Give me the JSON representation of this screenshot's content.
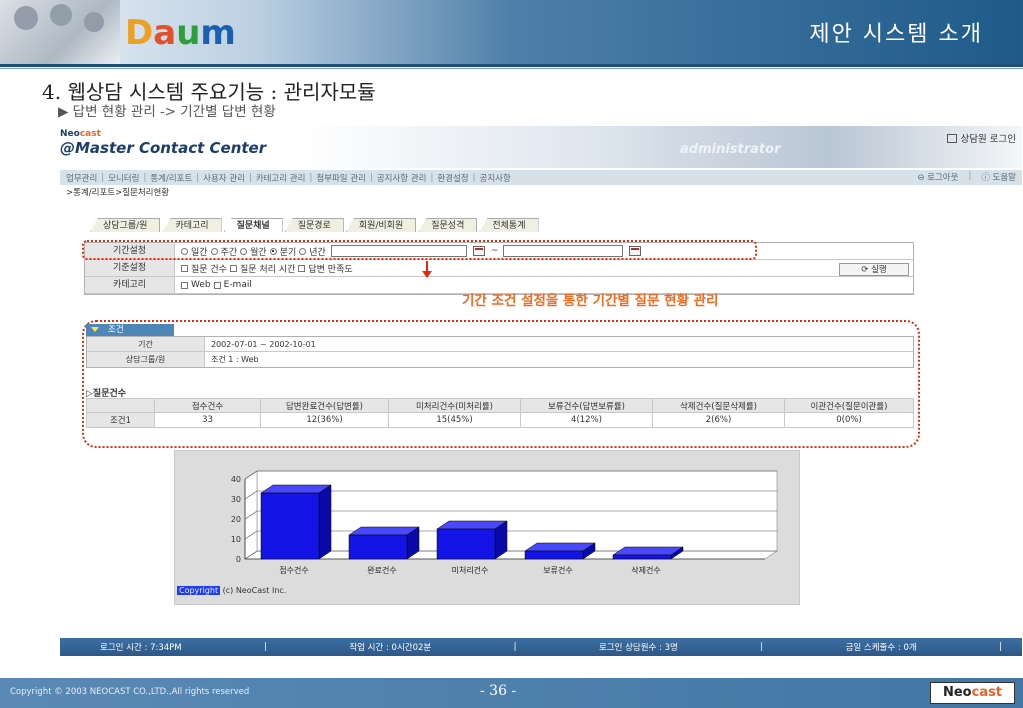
{
  "slide": {
    "title": "제안 시스템 소개",
    "logo": {
      "c1": "D",
      "c2": "a",
      "c3": "u",
      "c4": "m"
    },
    "heading": "4. 웹상담 시스템 주요기능 : 관리자모듈",
    "subheading": "▶ 답변 현황 관리 -> 기간별 답변 현황",
    "footer": {
      "copyright": "Copyright © 2003 NEOCAST CO.,LTD.,All rights reserved",
      "page": "- 36 -",
      "logo_neo": "Neo",
      "logo_cast": "cast"
    }
  },
  "app": {
    "brand_neo_a": "Neo",
    "brand_neo_b": "cast",
    "brand_main": "@Master Contact Center",
    "admin": "administrator",
    "login_button": "상담원 로그인",
    "menu": [
      "업무관리",
      "모니터링",
      "통계/리포트",
      "사용자 관리",
      "카테고리 관리",
      "첨부파일 관리",
      "공지사항 관리",
      "환경설정",
      "공지사항"
    ],
    "logout": "로그아웃",
    "help": "도움말",
    "breadcrumb": ">통계/리포트>질문처리현황",
    "tabs": [
      "상담그룹/원",
      "카테고리",
      "질문채널",
      "질문경로",
      "회원/비회원",
      "질문성격",
      "전체통계"
    ],
    "form": {
      "period_label": "기간설정",
      "period_options": [
        "일간",
        "주간",
        "월간",
        "분기",
        "년간"
      ],
      "period_selected": "분기",
      "date_sep": "~",
      "criteria_label": "기준설정",
      "criteria_options": [
        "질문 건수",
        "질문 처리 시간",
        "답변 만족도"
      ],
      "category_label": "카테고리",
      "category_options": [
        "Web",
        "E-mail"
      ],
      "run_button": "실행"
    },
    "annotation": "기간 조건 설정을 통한 기간별 질문 현황  관리",
    "conditions": {
      "header": "조건",
      "rows": [
        {
          "label": "기간",
          "value": "2002-07-01 ~ 2002-10-01"
        },
        {
          "label": "상담그룹/원",
          "value": "조건 1 : Web"
        }
      ]
    },
    "questions": {
      "title": "▷질문건수",
      "columns": [
        "",
        "접수건수",
        "답변완료건수(답변률)",
        "미처리건수(미처리률)",
        "보류건수(답변보류률)",
        "삭제건수(질문삭제률)",
        "이관건수(질문이관률)"
      ],
      "rows": [
        [
          "조건1",
          "33",
          "12(36%)",
          "15(45%)",
          "4(12%)",
          "2(6%)",
          "0(0%)"
        ]
      ]
    },
    "chart_copyright_a": "Copyright",
    "chart_copyright_b": " (c) NeoCast Inc.",
    "status": {
      "login_time": "로그인 시간 : 7:34PM",
      "work_time": "작업 시간 : 0시간02분",
      "counselors": "로그인 상담원수 : 3명",
      "schedule": "금일 스케줄수 : 0개"
    }
  },
  "chart_data": {
    "type": "bar",
    "categories": [
      "접수건수",
      "완료건수",
      "미처리건수",
      "보류건수",
      "삭제건수"
    ],
    "values": [
      33,
      12,
      15,
      4,
      2
    ],
    "ylim": [
      0,
      40
    ],
    "yticks": [
      0,
      10,
      20,
      30,
      40
    ],
    "bar_color": "#1414e6",
    "style": "3d",
    "grid": true
  }
}
